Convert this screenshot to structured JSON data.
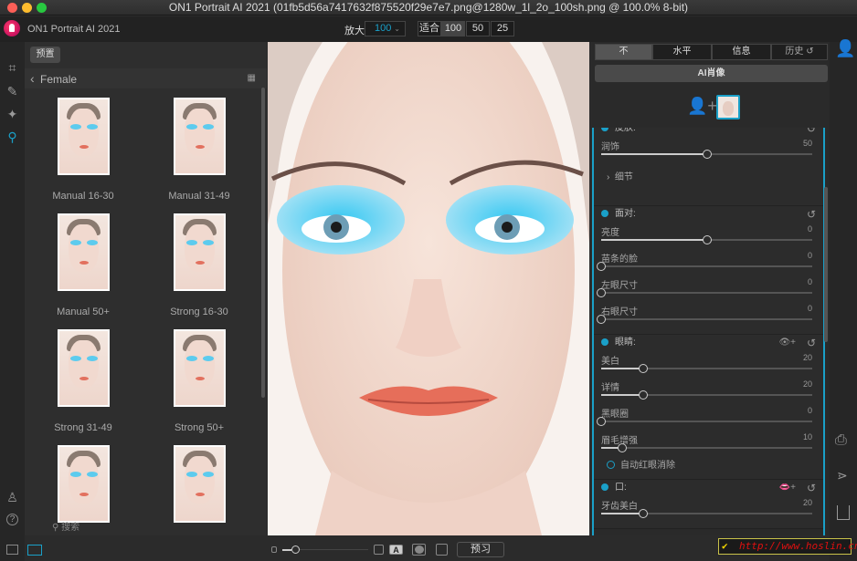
{
  "window": {
    "title": "ON1 Portrait AI 2021 (01fb5d56a7417632f875520f29e7e7.png@1280w_1l_2o_100sh.png @ 100.0% 8-bit)"
  },
  "toolbar": {
    "app_name": "ON1 Portrait AI 2021",
    "zoom_label": "放大",
    "zoom_value": "100",
    "fit_label": "适合",
    "zoom_options": [
      "100",
      "50",
      "25"
    ]
  },
  "presets": {
    "tab_label": "预置",
    "category": "Female",
    "search_placeholder": "搜索",
    "items": [
      {
        "label": "Manual 16-30"
      },
      {
        "label": "Manual 31-49"
      },
      {
        "label": "Manual 50+"
      },
      {
        "label": "Strong 16-30"
      },
      {
        "label": "Strong 31-49"
      },
      {
        "label": "Strong 50+"
      },
      {
        "label": ""
      },
      {
        "label": ""
      }
    ]
  },
  "panel": {
    "tabs": [
      "不",
      "水平",
      "信息",
      "历史"
    ],
    "ai_button": "AI肖像",
    "sections": [
      {
        "title": "皮肤:",
        "sliders": [
          {
            "label": "润饰",
            "value": 50
          }
        ],
        "detail": "细节"
      },
      {
        "title": "面对:",
        "sliders": [
          {
            "label": "亮度",
            "value": 0,
            "center": true
          },
          {
            "label": "苗条的脸",
            "value": 0
          },
          {
            "label": "左眼尺寸",
            "value": 0
          },
          {
            "label": "右眼尺寸",
            "value": 0
          }
        ]
      },
      {
        "title": "眼睛:",
        "sliders": [
          {
            "label": "美白",
            "value": 20
          },
          {
            "label": "详情",
            "value": 20
          },
          {
            "label": "黑眼圈",
            "value": 0
          },
          {
            "label": "眉毛增强",
            "value": 10
          }
        ],
        "checkbox": "自动红眼消除"
      },
      {
        "title": "口:",
        "sliders": [
          {
            "label": "牙齿美白",
            "value": 20
          }
        ]
      }
    ]
  },
  "bottom": {
    "preview_label": "预习"
  },
  "watermark": "http://www.hoslin.cn/",
  "colors": {
    "accent": "#1aa0c8"
  }
}
